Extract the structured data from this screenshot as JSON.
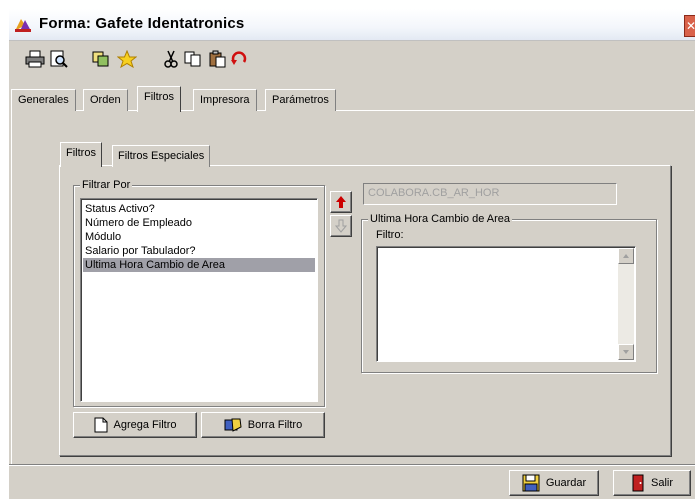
{
  "window": {
    "title": "Forma: Gafete Identatronics"
  },
  "toolbar": {
    "icons": [
      "printer-icon",
      "print-preview-icon",
      "copy-form-icon",
      "favorite-star-icon",
      "cut-icon",
      "copy-icon",
      "paste-icon",
      "undo-icon"
    ]
  },
  "tabs": [
    {
      "label": "Generales"
    },
    {
      "label": "Orden"
    },
    {
      "label": "Filtros",
      "active": true
    },
    {
      "label": "Impresora"
    },
    {
      "label": "Parámetros"
    }
  ],
  "inner_tabs": [
    {
      "label": "Filtros",
      "active": true
    },
    {
      "label": "Filtros Especiales"
    }
  ],
  "filter_group": {
    "label": "Filtrar Por",
    "items": [
      "Status Activo?",
      "Número de Empleado",
      "Módulo",
      "Salario por Tabulador?",
      "Ultima Hora Cambio de Area"
    ],
    "selected_index": 4
  },
  "buttons": {
    "add_filter": "Agrega Filtro",
    "remove_filter": "Borra Filtro",
    "save": "Guardar",
    "exit": "Salir"
  },
  "field_name": "COLABORA.CB_AR_HOR",
  "detail_group": {
    "label": "Ultima Hora Cambio de Area",
    "filter_label": "Filtro:",
    "filter_value": ""
  },
  "colors": {
    "window_bg": "#d4d0c8",
    "selection": "#a0a0a8",
    "close_button": "#d9624a",
    "up_arrow": "#cc0000"
  }
}
